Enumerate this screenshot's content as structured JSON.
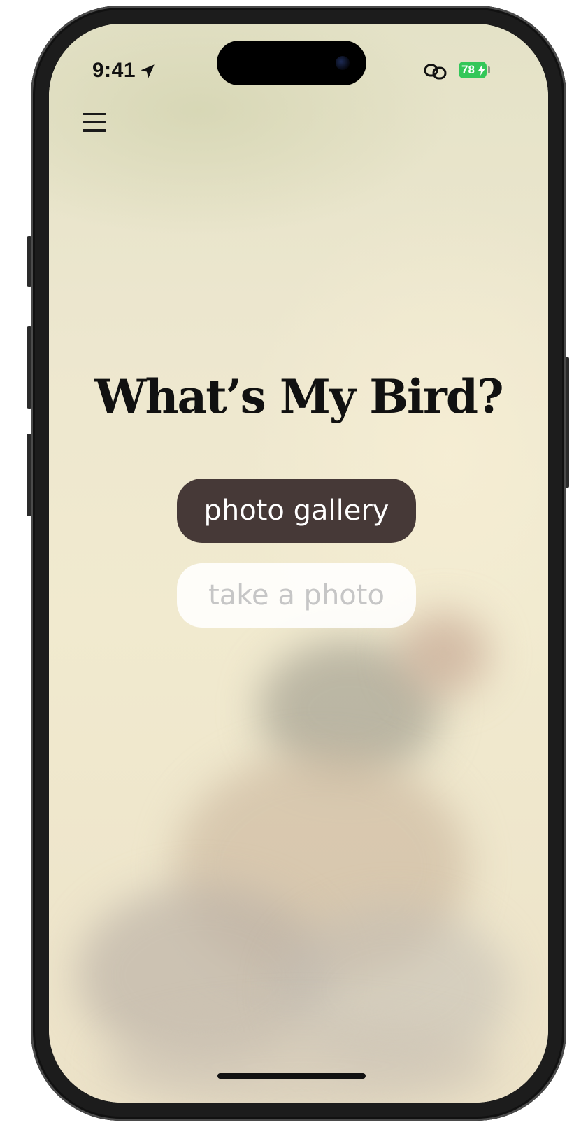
{
  "status_bar": {
    "time": "9:41",
    "battery_level": "78",
    "battery_color": "#34c759",
    "icons": [
      "location-arrow-icon",
      "link-icon",
      "battery-charging-icon"
    ]
  },
  "menu": {
    "icon": "hamburger-menu-icon"
  },
  "main": {
    "title": "What’s My Bird?",
    "photo_gallery_label": "photo gallery",
    "take_photo_label": "take a photo"
  },
  "colors": {
    "background": "#ece6cc",
    "primary_button": "#463937",
    "primary_button_text": "#ffffff",
    "secondary_button": "#ffffff",
    "secondary_button_text": "#c6c6c6",
    "title_text": "#111111"
  }
}
